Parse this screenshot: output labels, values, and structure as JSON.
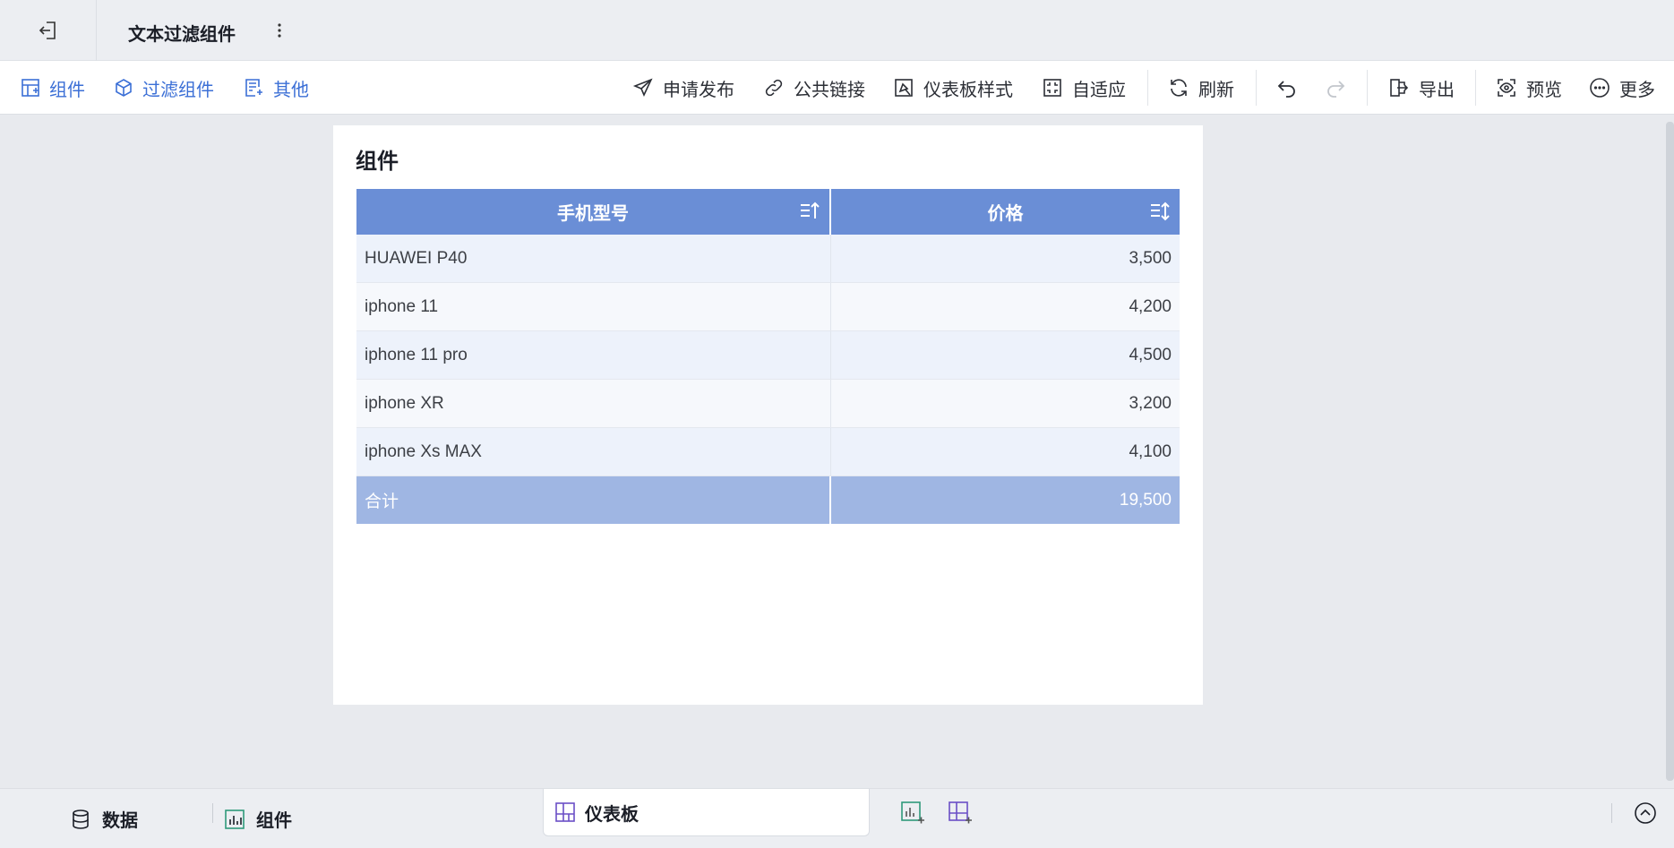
{
  "titlebar": {
    "title": "文本过滤组件"
  },
  "toolbar": {
    "left": [
      {
        "label": "组件",
        "icon": "add-widget-icon"
      },
      {
        "label": "过滤组件",
        "icon": "filter-widget-icon"
      },
      {
        "label": "其他",
        "icon": "other-widget-icon"
      }
    ],
    "right": {
      "publish": "申请发布",
      "public_link": "公共链接",
      "dashboard_style": "仪表板样式",
      "adaptive": "自适应",
      "refresh": "刷新",
      "export": "导出",
      "preview": "预览",
      "more": "更多"
    }
  },
  "widget": {
    "title": "组件",
    "table": {
      "columns": [
        "手机型号",
        "价格"
      ],
      "rows": [
        [
          "HUAWEI P40",
          "3,500"
        ],
        [
          "iphone 11",
          "4,200"
        ],
        [
          "iphone 11 pro",
          "4,500"
        ],
        [
          "iphone XR",
          "3,200"
        ],
        [
          "iphone Xs MAX",
          "4,100"
        ]
      ],
      "total": [
        "合计",
        "19,500"
      ]
    }
  },
  "bottombar": {
    "data_tab": "数据",
    "widget_tab": "组件",
    "dashboard_tab": "仪表板"
  },
  "colors": {
    "accent": "#3b6fd6",
    "table_header": "#6a8ed6",
    "table_total": "#9fb6e3"
  }
}
